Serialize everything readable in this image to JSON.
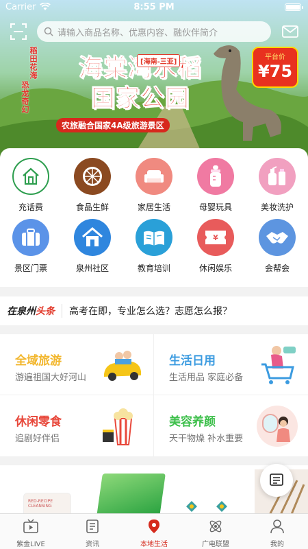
{
  "status_bar": {
    "carrier": "Carrier",
    "time": "8:55 PM"
  },
  "search": {
    "placeholder": "请输入商品名称、优惠内容、融伙伴简介"
  },
  "banner": {
    "side_left": "稻田花海",
    "side_right": "恐龙奇幻",
    "region_tag": "[海南-三亚]",
    "title_line1": "海棠湾水稻",
    "title_line2": "国家公园",
    "subtitle": "农旅融合国家4A级旅游景区",
    "price_label": "平台价",
    "price_value": "¥75"
  },
  "categories": [
    {
      "label": "充话费",
      "icon": "home-outline-icon",
      "color": "#2e9e4f"
    },
    {
      "label": "食品生鲜",
      "icon": "citrus-icon",
      "color": "#8b4a21"
    },
    {
      "label": "家居生活",
      "icon": "sofa-icon",
      "color": "#f08a80"
    },
    {
      "label": "母婴玩具",
      "icon": "baby-bottle-icon",
      "color": "#f07aa2"
    },
    {
      "label": "美妆洗护",
      "icon": "cosmetics-icon",
      "color": "#f1a0c0"
    },
    {
      "label": "景区门票",
      "icon": "suitcase-icon",
      "color": "#5b93e8"
    },
    {
      "label": "泉州社区",
      "icon": "house-icon",
      "color": "#2f86de"
    },
    {
      "label": "教育培训",
      "icon": "book-icon",
      "color": "#2aa0d8"
    },
    {
      "label": "休闲娱乐",
      "icon": "ticket-icon",
      "color": "#e85b5b"
    },
    {
      "label": "会帮会",
      "icon": "handshake-icon",
      "color": "#5d95e0"
    }
  ],
  "headline": {
    "brand_a": "在泉州",
    "brand_b": "头条",
    "text": "高考在即，专业怎么选？志愿怎么报？"
  },
  "promos": [
    {
      "title": "全域旅游",
      "subtitle": "游遍祖国大好河山",
      "color": "#f2b62c",
      "icon": "car-trip-icon"
    },
    {
      "title": "生活日用",
      "subtitle": "生活用品 家庭必备",
      "color": "#3b9be0",
      "icon": "shopping-cart-icon"
    },
    {
      "title": "休闲零食",
      "subtitle": "追剧好伴侣",
      "color": "#e8483b",
      "icon": "popcorn-icon"
    },
    {
      "title": "美容养颜",
      "subtitle": "天干物燥 补水重要",
      "color": "#3cbf4a",
      "icon": "mirror-beauty-icon"
    }
  ],
  "products": {
    "cream_text1": "RED-RECIPE",
    "cream_text2": "CLEANSING"
  },
  "tabs": [
    {
      "label": "紫金LIVE",
      "icon": "tv-play-icon"
    },
    {
      "label": "资讯",
      "icon": "news-icon"
    },
    {
      "label": "本地生活",
      "icon": "location-pin-icon",
      "active": true
    },
    {
      "label": "广电联盟",
      "icon": "atom-icon"
    },
    {
      "label": "我的",
      "icon": "person-icon"
    }
  ],
  "colors": {
    "accent": "#d52b1e"
  }
}
